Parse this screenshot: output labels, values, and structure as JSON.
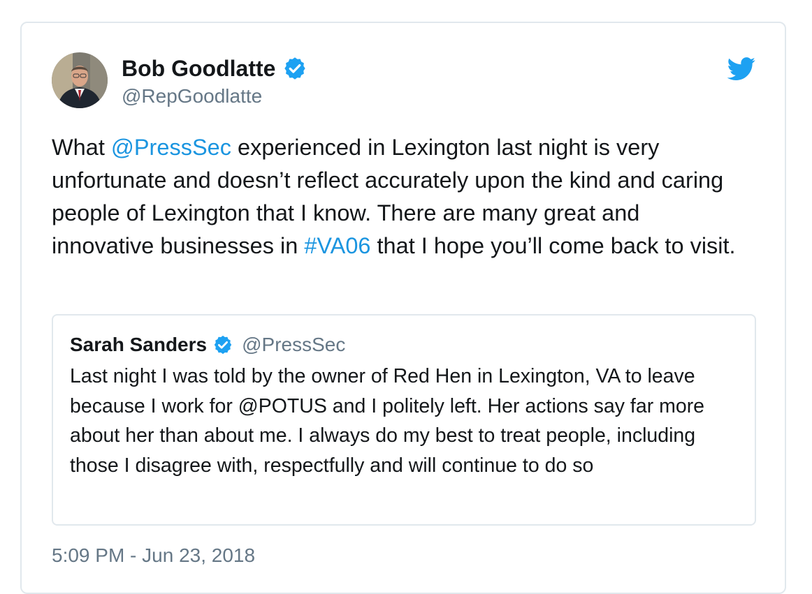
{
  "author": {
    "display_name": "Bob Goodlatte",
    "handle": "@RepGoodlatte",
    "verified": true
  },
  "tweet": {
    "segments": [
      {
        "text": "What ",
        "link": false
      },
      {
        "text": "@PressSec",
        "link": true
      },
      {
        "text": " experienced in Lexington last night is very unfortunate and doesn’t reflect accurately upon the kind and caring people of Lexington that I know. There are many great and innovative businesses in ",
        "link": false
      },
      {
        "text": "#VA06",
        "link": true
      },
      {
        "text": " that I hope you’ll come back to visit.",
        "link": false
      }
    ],
    "timestamp": "5:09 PM - Jun 23, 2018"
  },
  "quoted_tweet": {
    "display_name": "Sarah Sanders",
    "handle": "@PressSec",
    "verified": true,
    "text": "Last night I was told by the owner of Red Hen in Lexington, VA to leave because I work for @POTUS and I politely left. Her actions say far more about her than about me. I always do my best to treat people, including those I disagree with, respectfully and will continue to do so"
  },
  "icons": {
    "verified_badge": "verified-badge-icon",
    "platform": "twitter-bird-icon"
  },
  "colors": {
    "link": "#1b95e0",
    "verified": "#1da1f2",
    "secondary_text": "#657786",
    "border": "#e1e8ed"
  }
}
